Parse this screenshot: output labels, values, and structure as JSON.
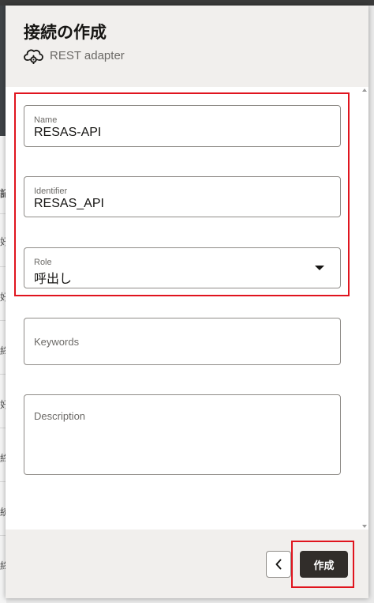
{
  "drawer": {
    "title": "接続の作成",
    "subtitle": "REST adapter",
    "adapter_icon": "cloud-gear-icon"
  },
  "form": {
    "name": {
      "label": "Name",
      "value": "RESAS-API"
    },
    "identifier": {
      "label": "Identifier",
      "value": "RESAS_API"
    },
    "role": {
      "label": "Role",
      "value": "呼出し"
    },
    "keywords": {
      "placeholder": "Keywords",
      "value": ""
    },
    "description": {
      "placeholder": "Description",
      "value": ""
    }
  },
  "footer": {
    "back_icon": "chevron-left-icon",
    "create_label": "作成"
  },
  "background": {
    "fragments": [
      "記",
      "好",
      "好",
      "終",
      "好",
      "終",
      "統",
      "終"
    ]
  },
  "colors": {
    "highlight": "#e0141e",
    "primary_button": "#312d2a",
    "header_bg": "#f1efed"
  }
}
